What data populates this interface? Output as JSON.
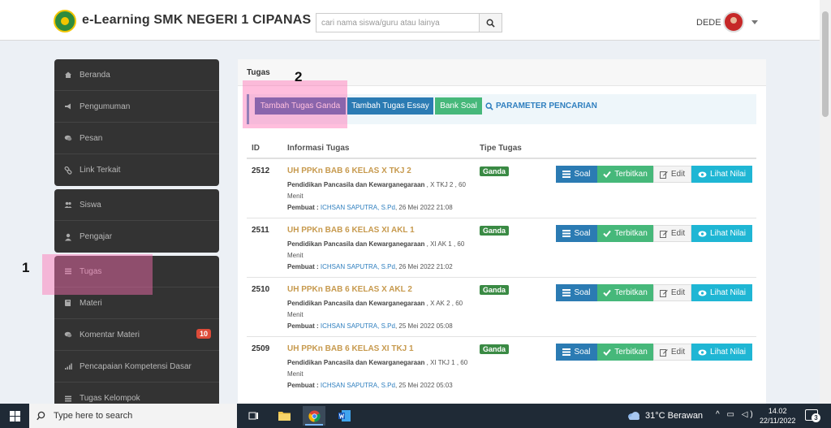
{
  "header": {
    "brand": "e-Learning SMK NEGERI 1 CIPANAS",
    "search_placeholder": "cari nama siswa/guru atau lainya",
    "user": "DEDE"
  },
  "sidebar": {
    "groups": [
      [
        {
          "label": "Beranda",
          "icon": "home-icon"
        },
        {
          "label": "Pengumuman",
          "icon": "bullhorn-icon"
        },
        {
          "label": "Pesan",
          "icon": "chat-icon"
        },
        {
          "label": "Link Terkait",
          "icon": "link-icon"
        }
      ],
      [
        {
          "label": "Siswa",
          "icon": "users-icon"
        },
        {
          "label": "Pengajar",
          "icon": "user-icon"
        }
      ],
      [
        {
          "label": "Tugas",
          "icon": "list-icon"
        },
        {
          "label": "Materi",
          "icon": "book-icon"
        },
        {
          "label": "Komentar Materi",
          "icon": "comments-icon",
          "badge": "10"
        },
        {
          "label": "Pencapaian Kompetensi Dasar",
          "icon": "signal-icon"
        },
        {
          "label": "Tugas Kelompok",
          "icon": "list-icon"
        }
      ]
    ]
  },
  "annotations": {
    "one": "1",
    "two": "2"
  },
  "content": {
    "title": "Tugas",
    "toolbar": {
      "add_ganda": "Tambah Tugas Ganda",
      "add_essay": "Tambah Tugas Essay",
      "bank_soal": "Bank Soal",
      "param": "PARAMETER PENCARIAN"
    },
    "columns": {
      "id": "ID",
      "info": "Informasi Tugas",
      "type": "Tipe Tugas"
    },
    "actions": {
      "soal": "Soal",
      "terbitkan": "Terbitkan",
      "edit": "Edit",
      "lihat": "Lihat Nilai"
    },
    "rows": [
      {
        "id": "2512",
        "title": "UH PPKn BAB 6 KELAS X TKJ 2",
        "subject": "Pendidikan Pancasila dan Kewarganegaraan",
        "class_info": " , X TKJ 2 , 60 Menit",
        "by_label": "Pembuat : ",
        "teacher": "ICHSAN SAPUTRA, S.Pd",
        "date": ", 26 Mei 2022 21:08",
        "type": "Ganda"
      },
      {
        "id": "2511",
        "title": "UH PPKn BAB 6 KELAS XI AKL 1",
        "subject": "Pendidikan Pancasila dan Kewarganegaraan",
        "class_info": " , XI AK 1 , 60 Menit",
        "by_label": "Pembuat : ",
        "teacher": "ICHSAN SAPUTRA, S.Pd",
        "date": ", 26 Mei 2022 21:02",
        "type": "Ganda"
      },
      {
        "id": "2510",
        "title": "UH PPKn BAB 6 KELAS X AKL 2",
        "subject": "Pendidikan Pancasila dan Kewarganegaraan",
        "class_info": " , X AK 2 , 60 Menit",
        "by_label": "Pembuat : ",
        "teacher": "ICHSAN SAPUTRA, S.Pd",
        "date": ", 25 Mei 2022 05:08",
        "type": "Ganda"
      },
      {
        "id": "2509",
        "title": "UH PPKn BAB 6 KELAS XI TKJ 1",
        "subject": "Pendidikan Pancasila dan Kewarganegaraan",
        "class_info": " , XI TKJ 1 , 60 Menit",
        "by_label": "Pembuat : ",
        "teacher": "ICHSAN SAPUTRA, S.Pd",
        "date": ", 25 Mei 2022 05:03",
        "type": "Ganda"
      }
    ]
  },
  "taskbar": {
    "search_placeholder": "Type here to search",
    "weather": "31°C  Berawan",
    "time": "14.02",
    "date": "22/11/2022",
    "notif_count": "3"
  },
  "colors": {
    "accent": "#3c8dbc",
    "success": "#46b87a",
    "info": "#1fb6d4",
    "highlight": "#ff6eb4"
  }
}
